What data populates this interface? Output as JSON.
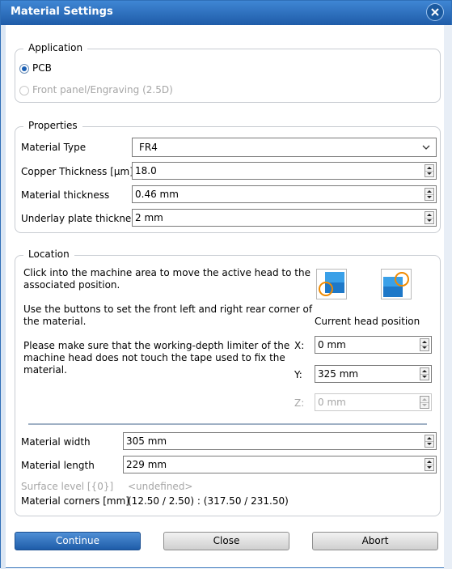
{
  "window": {
    "title": "Material Settings"
  },
  "application": {
    "legend": "Application",
    "options": [
      "PCB",
      "Front panel/Engraving (2.5D)"
    ],
    "selected": "PCB"
  },
  "properties": {
    "legend": "Properties",
    "material_type_label": "Material Type",
    "material_type_value": "FR4",
    "copper_label": "Copper Thickness [µm]",
    "copper_value": "18.0",
    "thickness_label": "Material thickness",
    "thickness_value": "0.46 mm",
    "underlay_label": "Underlay plate thickness",
    "underlay_value": "2 mm"
  },
  "location": {
    "legend": "Location",
    "instruction_1": [
      "Click into the machine area to move the active head to the",
      "associated position."
    ],
    "instruction_2": [
      "Use the buttons to set the front left and right rear corner of",
      "the material."
    ],
    "instruction_3": [
      "Please make sure that the working-depth limiter of the",
      "machine head does not touch the tape used to fix the",
      "material."
    ],
    "current_head_label": "Current head position",
    "x_label": "X:",
    "x_value": "0 mm",
    "y_label": "Y:",
    "y_value": "325 mm",
    "z_label": "Z:",
    "z_value": "0 mm",
    "width_label": "Material width",
    "width_value": "305 mm",
    "length_label": "Material length",
    "length_value": "229 mm",
    "surface_label": "Surface level [{0}]",
    "surface_value": "<undefined>",
    "corners_label": "Material corners [mm]",
    "corners_value": "(12.50 / 2.50) : (317.50 / 231.50)"
  },
  "buttons": {
    "continue": "Continue",
    "close": "Close",
    "abort": "Abort"
  },
  "icons": [
    "front-left-corner-icon",
    "rear-right-corner-icon",
    "close-icon",
    "chevron-down-icon"
  ]
}
